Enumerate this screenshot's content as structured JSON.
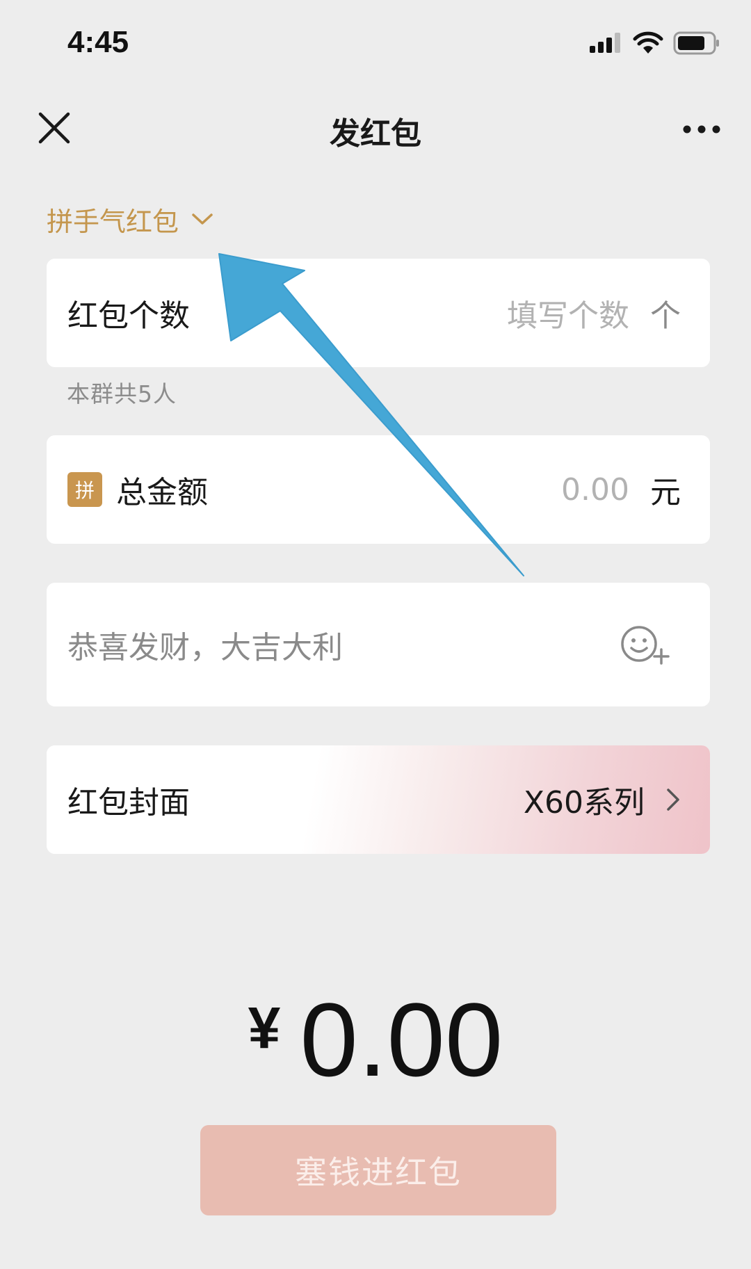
{
  "status_bar": {
    "time": "4:45"
  },
  "nav": {
    "title": "发红包"
  },
  "type_selector": {
    "label": "拼手气红包"
  },
  "count_row": {
    "label": "红包个数",
    "placeholder": "填写个数",
    "unit": "个"
  },
  "group_hint": "本群共5人",
  "amount_row": {
    "badge": "拼",
    "label": "总金额",
    "placeholder": "0.00",
    "unit": "元"
  },
  "greeting": {
    "placeholder": "恭喜发财，大吉大利"
  },
  "cover_row": {
    "label": "红包封面",
    "value": "X60系列"
  },
  "total": {
    "currency": "¥",
    "value": "0.00"
  },
  "submit": {
    "label": "塞钱进红包"
  },
  "colors": {
    "accent_gold": "#c4964d",
    "annotation_blue": "#45a7d6",
    "submit_disabled": "#e8bcb1"
  },
  "icons": [
    "signal-icon",
    "wifi-icon",
    "battery-icon",
    "close-icon",
    "more-icon",
    "chevron-down-icon",
    "emoji-add-icon",
    "chevron-right-icon",
    "annotation-arrow"
  ]
}
